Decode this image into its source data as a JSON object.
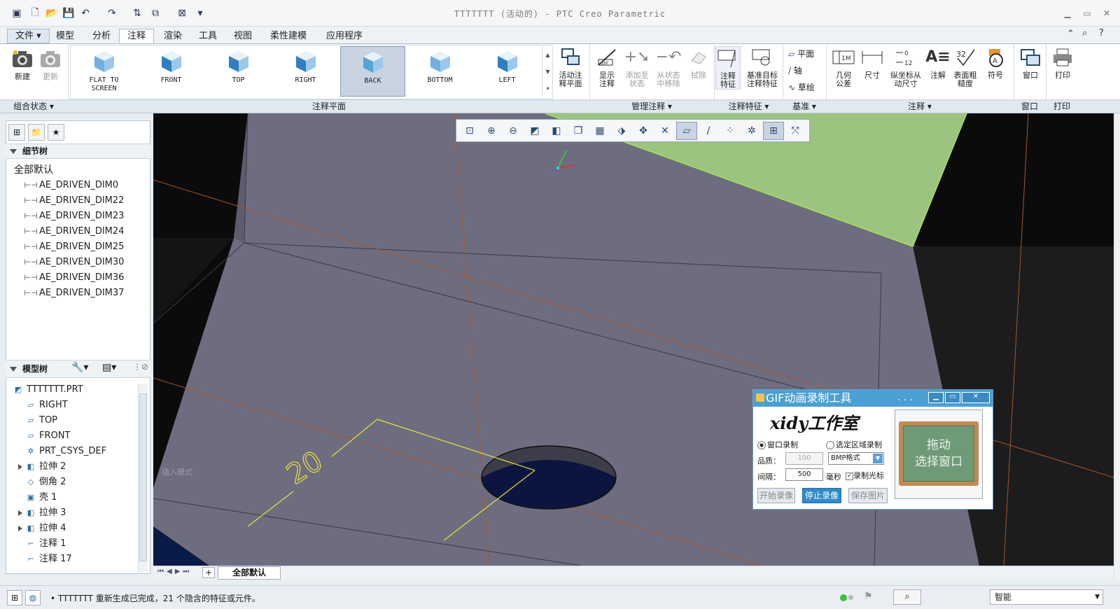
{
  "app": {
    "title": "TTTTTTT (活动的) - PTC Creo Parametric"
  },
  "menu_tabs": [
    "文件",
    "模型",
    "分析",
    "注释",
    "渲染",
    "工具",
    "视图",
    "柔性建模",
    "应用程序"
  ],
  "active_tab": "注释",
  "ribbon": {
    "combo_state": {
      "new": "新建",
      "update": "更新"
    },
    "annotation_planes": [
      {
        "label": "FLAT TO SCREEN"
      },
      {
        "label": "FRONT"
      },
      {
        "label": "TOP"
      },
      {
        "label": "RIGHT"
      },
      {
        "label": "BACK",
        "selected": true
      },
      {
        "label": "BOTTOM"
      },
      {
        "label": "LEFT"
      }
    ],
    "active_annotation_plane": "活动注释平面",
    "manage": [
      "显示注释",
      "添加至状态",
      "从状态中移除",
      "拭除"
    ],
    "annotation_feature": [
      "注释特征",
      "基准目标注释特征"
    ],
    "datum": [
      "平面",
      "轴",
      "草绘"
    ],
    "annotation": [
      "几何公差",
      "尺寸",
      "纵坐标从动尺寸",
      "注解",
      "表面粗糙度",
      "符号"
    ],
    "window": "窗口",
    "print": "打印",
    "groups": {
      "combo": "组合状态",
      "plane": "注释平面",
      "manage": "管理注释",
      "feature": "注释特征",
      "datum": "基准",
      "annotation": "注释",
      "window": "窗口",
      "print": "打印"
    }
  },
  "detail_tree": {
    "title": "细节树",
    "root": "全部默认",
    "items": [
      "AE_DRIVEN_DIM0",
      "AE_DRIVEN_DIM22",
      "AE_DRIVEN_DIM23",
      "AE_DRIVEN_DIM24",
      "AE_DRIVEN_DIM25",
      "AE_DRIVEN_DIM30",
      "AE_DRIVEN_DIM36",
      "AE_DRIVEN_DIM37"
    ]
  },
  "model_tree": {
    "title": "模型树",
    "items": [
      {
        "label": "TTTTTTT.PRT",
        "icon": "part-icon",
        "expand": false
      },
      {
        "label": "RIGHT",
        "icon": "datum-plane-icon",
        "expand": false
      },
      {
        "label": "TOP",
        "icon": "datum-plane-icon",
        "expand": false
      },
      {
        "label": "FRONT",
        "icon": "datum-plane-icon",
        "expand": false
      },
      {
        "label": "PRT_CSYS_DEF",
        "icon": "csys-icon",
        "expand": false
      },
      {
        "label": "拉伸 2",
        "icon": "extrude-icon",
        "expand": true
      },
      {
        "label": "倒角 2",
        "icon": "chamfer-icon",
        "expand": false
      },
      {
        "label": "壳 1",
        "icon": "shell-icon",
        "expand": false
      },
      {
        "label": "拉伸 3",
        "icon": "extrude-icon",
        "expand": true
      },
      {
        "label": "拉伸 4",
        "icon": "extrude-icon",
        "expand": true
      },
      {
        "label": "注释 1",
        "icon": "note-icon",
        "expand": false
      },
      {
        "label": "注释 17",
        "icon": "note-icon",
        "expand": false
      }
    ]
  },
  "viewport": {
    "insert_mode": "插入模式",
    "dimension_value": "20"
  },
  "bottom_tab": "全部默认",
  "status": {
    "message": "• TTTTTTT 重新生成已完成，21 个隐含的特征或元件。",
    "filter": "智能"
  },
  "gif_tool": {
    "title": "GIF动画录制工具",
    "studio": "xidy工作室",
    "mode_window": "窗口录制",
    "mode_region": "选定区域录制",
    "quality_label": "品质：",
    "quality_value": "100",
    "format": "BMP格式",
    "interval_label": "间隔：",
    "interval_value": "500",
    "interval_unit": "毫秒",
    "record_cursor": "录制光标",
    "btn_start": "开始录像",
    "btn_stop": "停止录像",
    "btn_save": "保存图片",
    "drag_line1": "拖动",
    "drag_line2": "选择窗口"
  },
  "colors": {
    "accent": "#4b9fd2",
    "face": "#6e6d80",
    "green_face": "#9cc37f",
    "dim": "#e6e23a"
  }
}
